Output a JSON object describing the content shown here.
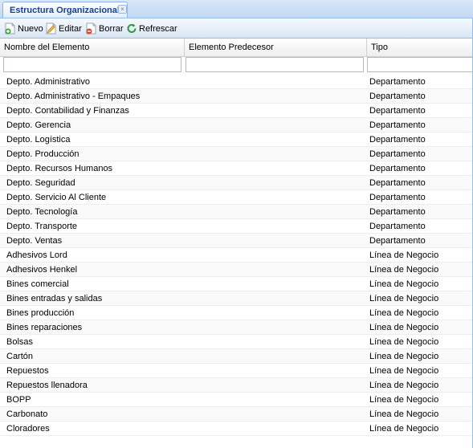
{
  "tab": {
    "title": "Estructura Organizacional",
    "close_glyph": "×"
  },
  "toolbar": {
    "nuevo": "Nuevo",
    "editar": "Editar",
    "borrar": "Borrar",
    "refrescar": "Refrescar",
    "icons": [
      "add-document-icon",
      "edit-document-icon",
      "delete-document-icon",
      "refresh-icon"
    ]
  },
  "grid": {
    "columns": [
      "Nombre del Elemento",
      "Elemento Predecesor",
      "Tipo"
    ],
    "filters": {
      "nombre": "",
      "predecesor": "",
      "tipo": ""
    },
    "rows": [
      {
        "nombre": "Depto. Administrativo",
        "predecesor": "",
        "tipo": "Departamento"
      },
      {
        "nombre": "Depto. Administrativo - Empaques",
        "predecesor": "",
        "tipo": "Departamento"
      },
      {
        "nombre": "Depto. Contabilidad y Finanzas",
        "predecesor": "",
        "tipo": "Departamento"
      },
      {
        "nombre": "Depto. Gerencia",
        "predecesor": "",
        "tipo": "Departamento"
      },
      {
        "nombre": "Depto. Logística",
        "predecesor": "",
        "tipo": "Departamento"
      },
      {
        "nombre": "Depto. Producción",
        "predecesor": "",
        "tipo": "Departamento"
      },
      {
        "nombre": "Depto. Recursos Humanos",
        "predecesor": "",
        "tipo": "Departamento"
      },
      {
        "nombre": "Depto. Seguridad",
        "predecesor": "",
        "tipo": "Departamento"
      },
      {
        "nombre": "Depto. Servicio Al Cliente",
        "predecesor": "",
        "tipo": "Departamento"
      },
      {
        "nombre": "Depto. Tecnología",
        "predecesor": "",
        "tipo": "Departamento"
      },
      {
        "nombre": "Depto. Transporte",
        "predecesor": "",
        "tipo": "Departamento"
      },
      {
        "nombre": "Depto. Ventas",
        "predecesor": "",
        "tipo": "Departamento"
      },
      {
        "nombre": "Adhesivos Lord",
        "predecesor": "",
        "tipo": "Línea de Negocio"
      },
      {
        "nombre": "Adhesivos Henkel",
        "predecesor": "",
        "tipo": "Línea de Negocio"
      },
      {
        "nombre": "Bines comercial",
        "predecesor": "",
        "tipo": "Línea de Negocio"
      },
      {
        "nombre": "Bines entradas y salidas",
        "predecesor": "",
        "tipo": "Línea de Negocio"
      },
      {
        "nombre": "Bines producción",
        "predecesor": "",
        "tipo": "Línea de Negocio"
      },
      {
        "nombre": "Bines reparaciones",
        "predecesor": "",
        "tipo": "Línea de Negocio"
      },
      {
        "nombre": "Bolsas",
        "predecesor": "",
        "tipo": "Línea de Negocio"
      },
      {
        "nombre": "Cartón",
        "predecesor": "",
        "tipo": "Línea de Negocio"
      },
      {
        "nombre": "Repuestos",
        "predecesor": "",
        "tipo": "Línea de Negocio"
      },
      {
        "nombre": "Repuestos llenadora",
        "predecesor": "",
        "tipo": "Línea de Negocio"
      },
      {
        "nombre": "BOPP",
        "predecesor": "",
        "tipo": "Línea de Negocio"
      },
      {
        "nombre": "Carbonato",
        "predecesor": "",
        "tipo": "Línea de Negocio"
      },
      {
        "nombre": "Cloradores",
        "predecesor": "",
        "tipo": "Línea de Negocio"
      }
    ]
  },
  "colors": {
    "accent": "#15428b",
    "border": "#99bbe8",
    "add": "#3aa635",
    "delete": "#d9452f",
    "refresh": "#2e9b3a"
  }
}
